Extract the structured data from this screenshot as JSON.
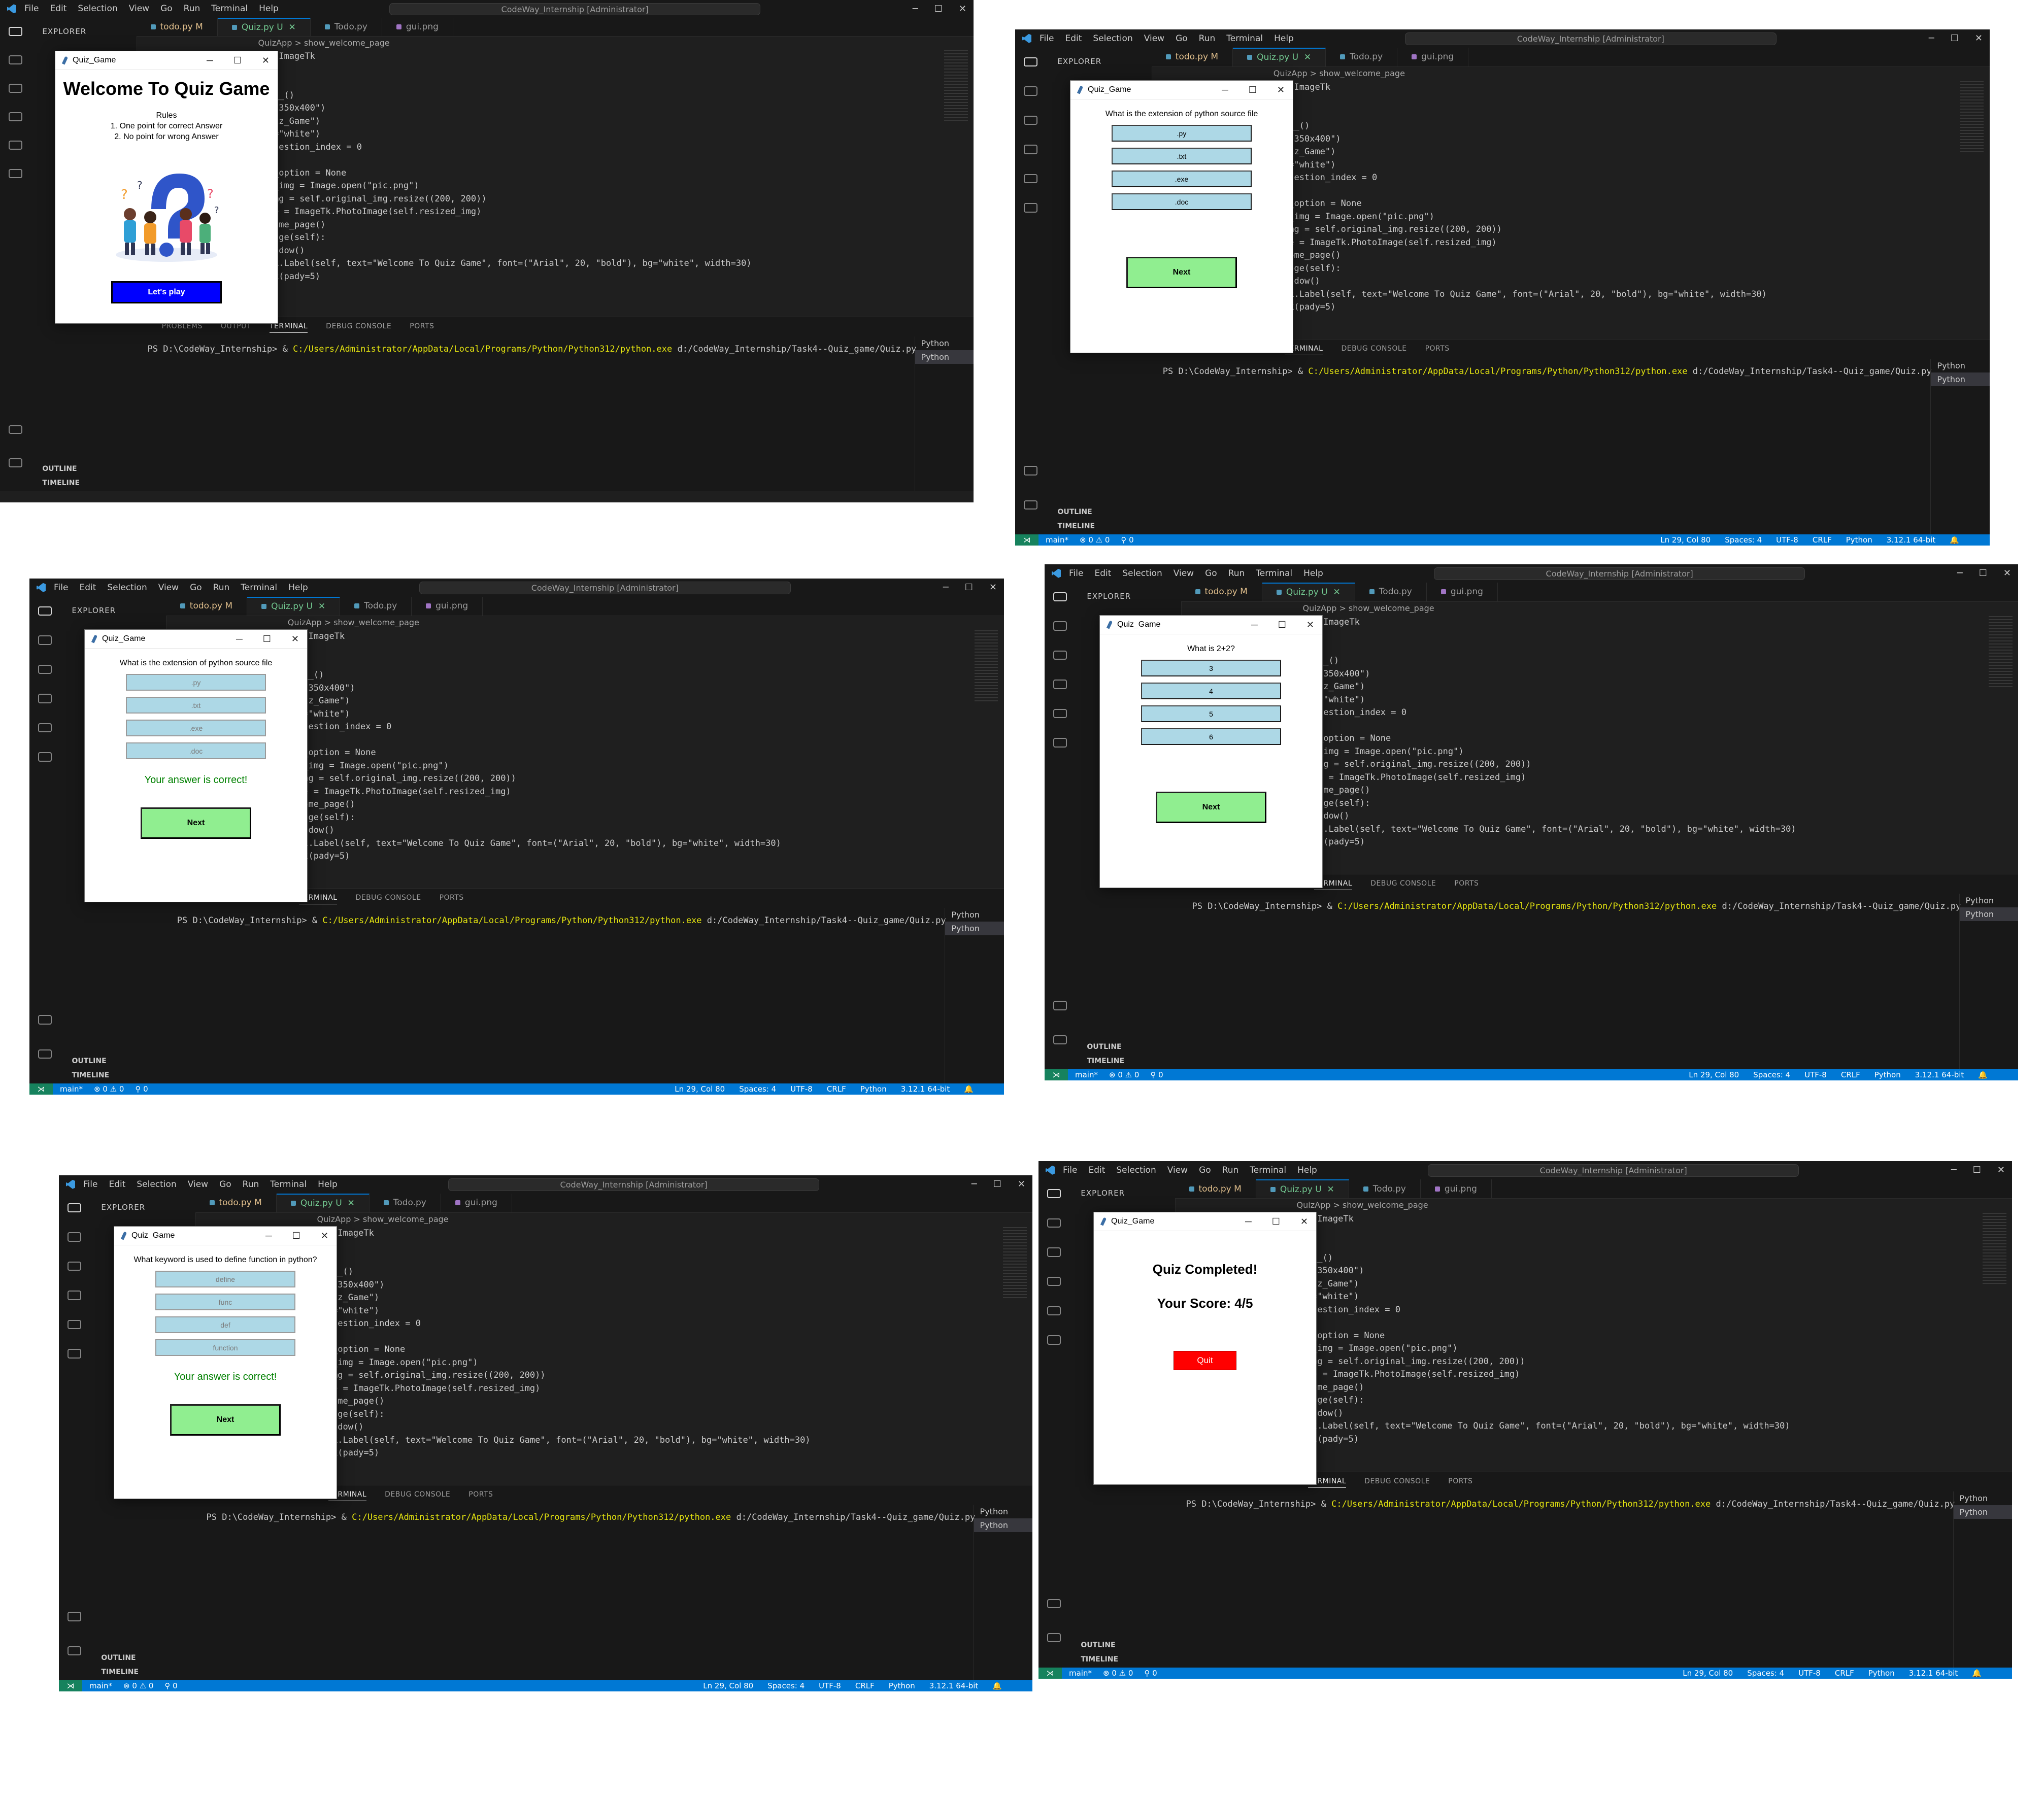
{
  "vscode": {
    "menu": [
      "File",
      "Edit",
      "Selection",
      "View",
      "Go",
      "Run",
      "Terminal",
      "Help"
    ],
    "command_center": "CodeWay_Internship [Administrator]",
    "explorer_label": "EXPLORER",
    "outline_label": "OUTLINE",
    "timeline_label": "TIMELINE",
    "tabs": [
      {
        "label": "todo.py",
        "badge": "M"
      },
      {
        "label": "Quiz.py",
        "badge": "U"
      },
      {
        "label": "Todo.py",
        "badge": ""
      },
      {
        "label": "gui.png",
        "badge": ""
      }
    ],
    "breadcrumb": "QuizApp > show_welcome_page",
    "code_lines": [
      "e, ImageTk",
      ":",
      "f):",
      "it__()",
      "y(\"350x400\")",
      "Quiz_Game\")",
      "bg=\"white\")",
      "_question_index = 0",
      "0",
      "ed_option = None",
      "",
      "al_img = Image.open(\"pic.png\")",
      "_img = self.original_img.resize((200, 200))",
      "age = ImageTk.PhotoImage(self.resized_img)",
      "lcome_page()",
      "",
      "_page(self):",
      "window()",
      " tk.Label(self, text=\"Welcome To Quiz Game\", font=(\"Arial\", 20, \"bold\"), bg=\"white\", width=30)",
      "ack(pady=5)"
    ],
    "panel_tabs": [
      "PROBLEMS",
      "OUTPUT",
      "TERMINAL",
      "DEBUG CONSOLE",
      "PORTS"
    ],
    "terminal": {
      "prompt": "PS D:\\CodeWay_Internship> & ",
      "exe": "C:/Users/Administrator/AppData/Local/Programs/Python/Python312/python.exe",
      "arg": " d:/CodeWay_Internship/Task4--Quiz_game/Quiz.py"
    },
    "terminal_list": [
      "Python",
      "Python"
    ],
    "status": {
      "branch": "main*",
      "problems": "⊗ 0 ⚠ 0",
      "ports": "⚲ 0",
      "position": "Ln 29, Col 80",
      "spaces": "Spaces: 4",
      "encoding": "UTF-8",
      "eol": "CRLF",
      "language": "Python",
      "version": "3.12.1 64-bit"
    }
  },
  "dialog_title": "Quiz_Game",
  "welcome": {
    "title": "Welcome To Quiz Game",
    "rules": "Rules\n1. One point for correct Answer\n2. No point for wrong Answer",
    "button": "Let's play"
  },
  "q1": {
    "question": "What is the extension of python source file",
    "options": [
      ".py",
      ".txt",
      ".exe",
      ".doc"
    ]
  },
  "q2": {
    "question": "What is 2+2?",
    "options": [
      "3",
      "4",
      "5",
      "6"
    ]
  },
  "q3": {
    "question": "What keyword is used to define function in python?",
    "options": [
      "define",
      "func",
      "def",
      "function"
    ]
  },
  "feedback": "Your answer is correct!",
  "next_label": "Next",
  "result": {
    "title": "Quiz Completed!",
    "score": "Your Score: 4/5",
    "quit": "Quit"
  },
  "colors": {
    "option_bg": "#add8e6",
    "next_bg": "#90ee90",
    "play_bg": "#0000ff",
    "quit_bg": "#ff0000",
    "statusbar": "#0078d4",
    "correct": "#008000"
  }
}
